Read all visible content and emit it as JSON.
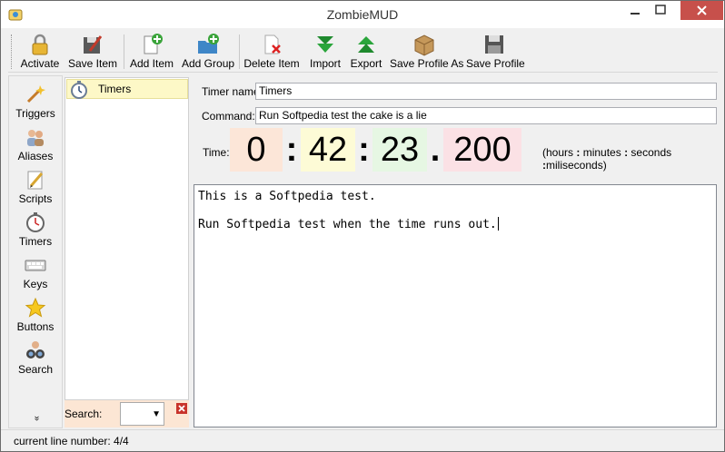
{
  "window": {
    "title": "ZombieMUD"
  },
  "toolbar": {
    "items": [
      {
        "label": "Activate",
        "icon": "lock-icon"
      },
      {
        "label": "Save Item",
        "icon": "save-item-icon"
      },
      {
        "label": "Add Item",
        "icon": "add-item-icon"
      },
      {
        "label": "Add Group",
        "icon": "add-group-icon"
      },
      {
        "label": "Delete Item",
        "icon": "delete-item-icon"
      },
      {
        "label": "Import",
        "icon": "import-arrow-icon"
      },
      {
        "label": "Export",
        "icon": "export-arrow-icon"
      },
      {
        "label": "Save Profile As",
        "icon": "package-icon"
      },
      {
        "label": "Save Profile",
        "icon": "floppy-icon"
      }
    ]
  },
  "leftnav": {
    "items": [
      {
        "label": "Triggers",
        "icon": "triggers-wand-icon"
      },
      {
        "label": "Aliases",
        "icon": "aliases-people-icon"
      },
      {
        "label": "Scripts",
        "icon": "scripts-pencil-icon"
      },
      {
        "label": "Timers",
        "icon": "timers-clock-icon"
      },
      {
        "label": "Keys",
        "icon": "keys-keyboard-icon"
      },
      {
        "label": "Buttons",
        "icon": "buttons-star-icon"
      },
      {
        "label": "Search",
        "icon": "search-binoculars-icon"
      }
    ],
    "more": "»"
  },
  "tree": {
    "items": [
      {
        "label": "Timers",
        "icon": "clock-icon"
      }
    ]
  },
  "search": {
    "label": "Search:",
    "value": ""
  },
  "form": {
    "timer_name_label": "Timer name:",
    "timer_name_value": "Timers",
    "command_label": "Command:",
    "command_value": "Run Softpedia test the cake is a lie",
    "time_label": "Time:",
    "hours": "0",
    "minutes": "42",
    "seconds": "23",
    "milliseconds": "200",
    "sep_colon": ":",
    "sep_dot": ".",
    "hint_open": "(hours",
    "hint_colon": ":",
    "hint_minutes": "minutes",
    "hint_seconds": "seconds",
    "hint_ms": "miliseconds)"
  },
  "editor": {
    "lines": [
      "This is a Softpedia test.",
      "Run Softpedia test when the time runs out."
    ]
  },
  "status": {
    "text": "current line number: 4/4"
  }
}
